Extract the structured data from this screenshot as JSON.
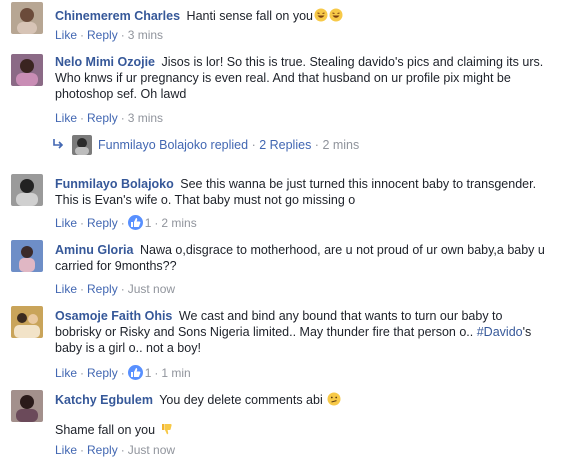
{
  "colors": {
    "link": "#4267b2",
    "author": "#365899",
    "meta": "#90949c",
    "text": "#1d2129",
    "like_bubble": "#5890ff"
  },
  "comments": [
    {
      "author": "Chinemerem Charles",
      "text": "Hanti sense fall on you",
      "emoji": [
        "laughing-icon",
        "laughing-icon"
      ],
      "like": "Like",
      "reply": "Reply",
      "time": "3 mins"
    },
    {
      "author": "Nelo Mimi Ozojie",
      "text": "Jisos is lor! So this is true. Stealing davido's pics and claiming its urs. Who knws if ur pregnancy is even real. And that husband on ur profile pix might be photoshop sef. Oh lawd",
      "like": "Like",
      "reply": "Reply",
      "time": "3 mins",
      "replies": {
        "name": "Funmilayo Bolajoko replied",
        "count": "2 Replies",
        "time": "2 mins"
      }
    },
    {
      "author": "Funmilayo Bolajoko",
      "text": "See this wanna be just turned this innocent baby to transgender. This is Evan's wife o. That baby must not go missing o",
      "like": "Like",
      "reply": "Reply",
      "reactions": "1",
      "time": "2 mins"
    },
    {
      "author": "Aminu Gloria",
      "text": "Nawa o,disgrace to motherhood, are u not proud of ur own baby,a baby u carried for 9months??",
      "like": "Like",
      "reply": "Reply",
      "time": "Just now"
    },
    {
      "author": "Osamoje Faith Ohis",
      "text": "We cast and bind any bound that wants to turn our baby to bobrisky or Risky and Sons Nigeria limited.. May thunder fire that person o..",
      "hashtag": "#Davido",
      "text_after": "'s baby is a girl o.. not a boy!",
      "like": "Like",
      "reply": "Reply",
      "reactions": "1",
      "time": "1 min"
    },
    {
      "author": "Katchy Egbulem",
      "text": "You dey delete comments abi",
      "text2": "Shame fall on you",
      "like": "Like",
      "reply": "Reply",
      "time": "Just now"
    }
  ]
}
